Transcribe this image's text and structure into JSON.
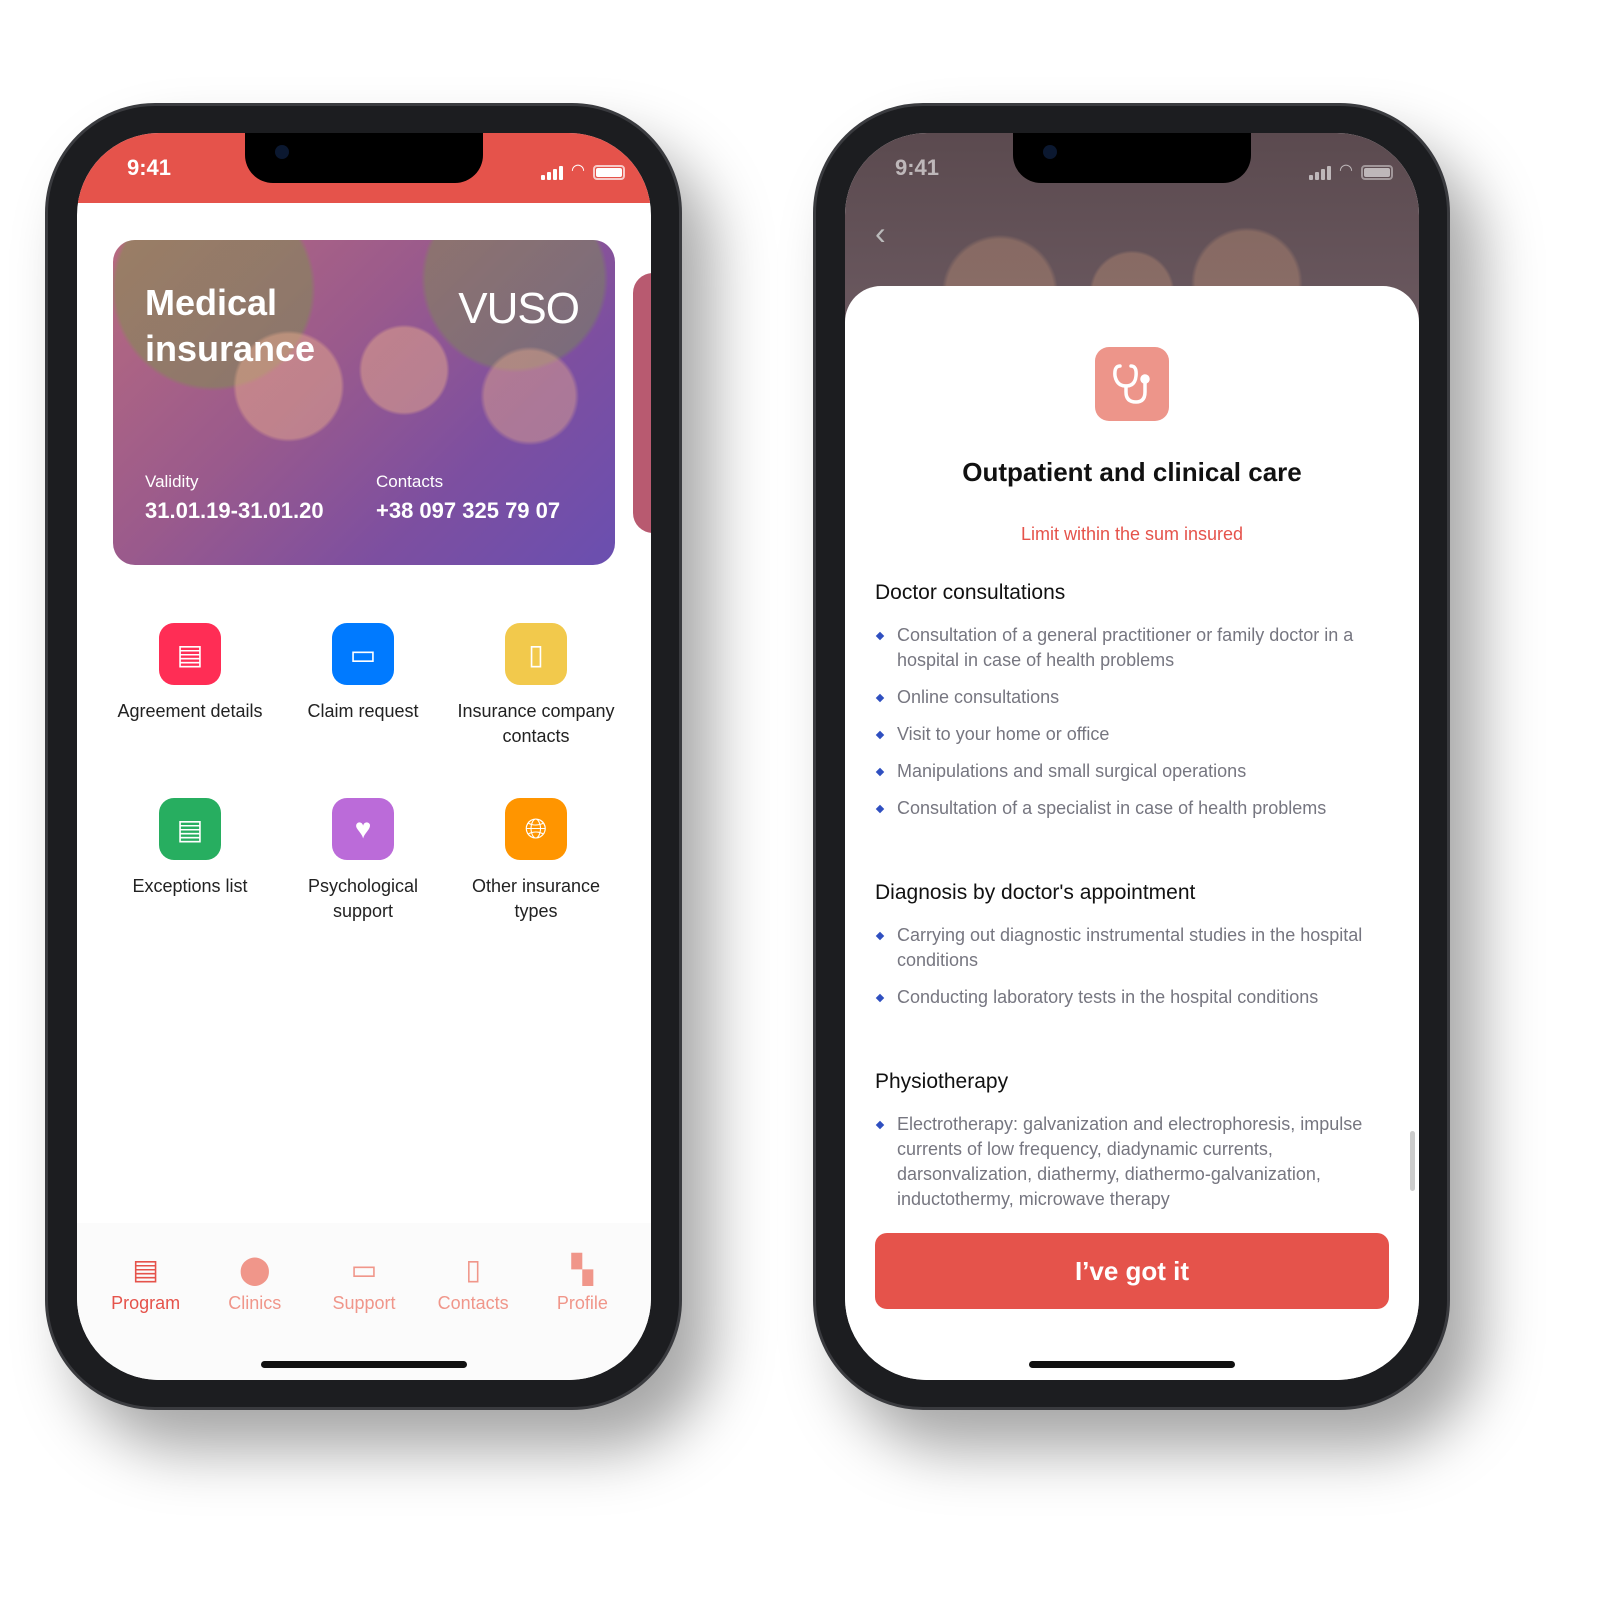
{
  "status": {
    "time": "9:41"
  },
  "home": {
    "card": {
      "title_line1": "Medical",
      "title_line2": "insurance",
      "logo": "VUSO",
      "validity_label": "Validity",
      "validity_value": "31.01.19-31.01.20",
      "contacts_label": "Contacts",
      "contacts_value": "+38 097 325 79 07"
    },
    "tiles": [
      {
        "label": "Agreement details",
        "icon": "document-icon",
        "color": "#ff2d55"
      },
      {
        "label": "Claim request",
        "icon": "card-icon",
        "color": "#007aff"
      },
      {
        "label": "Insurance company contacts",
        "icon": "phone-icon",
        "color": "#f2c94c"
      },
      {
        "label": "Exceptions list",
        "icon": "list-icon",
        "color": "#27ae60"
      },
      {
        "label": "Psychological support",
        "icon": "heart-icon",
        "color": "#bb6bd9"
      },
      {
        "label": "Other insurance types",
        "icon": "globe-icon",
        "color": "#ff9500"
      }
    ],
    "tabs": [
      {
        "label": "Program",
        "active": true
      },
      {
        "label": "Clinics"
      },
      {
        "label": "Support"
      },
      {
        "label": "Contacts"
      },
      {
        "label": "Profile"
      }
    ]
  },
  "detail": {
    "title": "Outpatient and clinical care",
    "limit": "Limit within the sum insured",
    "sections": [
      {
        "heading": "Doctor consultations",
        "items": [
          "Consultation of a general practitioner or family doctor in a hospital in case of health problems",
          "Online consultations",
          "Visit to your home or office",
          "Manipulations and small surgical operations",
          "Consultation of a specialist in case of health problems"
        ]
      },
      {
        "heading": "Diagnosis by doctor's appointment",
        "items": [
          "Carrying out diagnostic instrumental studies in the hospital conditions",
          "Conducting laboratory tests in the hospital conditions"
        ]
      },
      {
        "heading": "Physiotherapy",
        "items": [
          "Electrotherapy: galvanization and electrophoresis, impulse currents of low frequency, diadynamic currents, darsonvalization, diathermy, diathermo-galvanization, inductothermy, microwave therapy"
        ]
      }
    ],
    "button": "I’ve got it"
  },
  "colors": {
    "accent": "#e5534b",
    "tab_inactive": "#f0968a"
  }
}
